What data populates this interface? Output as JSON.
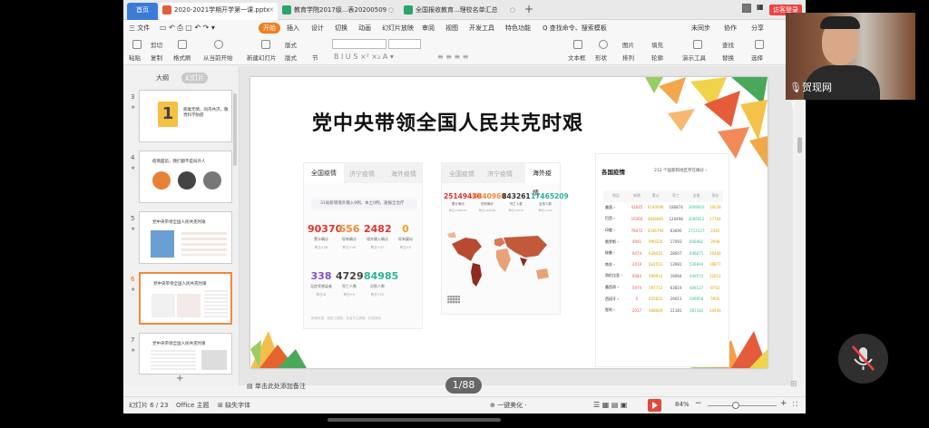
{
  "tabs": {
    "home": "首页",
    "t1": "2020-2021学期开学第一课.pptx",
    "t2": "教育学院2017级...表20200509",
    "t3": "全国报收教育...理校名单汇总",
    "login": "访客登录"
  },
  "menu": {
    "file": "三 文件",
    "items": [
      "开始",
      "插入",
      "设计",
      "切换",
      "动画",
      "幻灯片放映",
      "审阅",
      "视图",
      "开发工具",
      "特色功能"
    ],
    "search": "Q 查找命令、搜索模板",
    "right": [
      "未同步",
      "协作",
      "分享"
    ]
  },
  "ribbon": {
    "paste": "粘贴",
    "cut": "剪切",
    "copy": "复制",
    "format_painter": "格式刷",
    "from_current": "从当前开始",
    "new_slide": "新建幻灯片",
    "layout": "版式",
    "section": "节",
    "textbox": "文本框",
    "shape": "形状",
    "arrange": "排列",
    "outline": "轮廓",
    "picture": "图片",
    "fill": "填充",
    "find": "查找",
    "present_tool": "演示工具",
    "replace": "替换",
    "select": "选择"
  },
  "left_panel": {
    "tab_outline": "大纲",
    "tab_slides": "幻灯片",
    "slide_numbers": [
      "3",
      "4",
      "5",
      "6",
      "7"
    ],
    "thumb_titles": {
      "s3": "病毒无情，同舟共济，敬畏科学防疫",
      "s4": "疫情面前，我们都不是局外人",
      "s5": "党中央带领全国人民共克时艰",
      "s6": "党中央带领全国人民共克时艰",
      "s7": "党中央带领全国人民共克时艰"
    }
  },
  "slide": {
    "title": "党中央带领全国人民共克时艰",
    "china_panel": {
      "tabs": [
        "全国疫情",
        "济宁疫情",
        "海外疫情"
      ],
      "notice": "31省新增境外输入9例，本土0例，速报全治疗",
      "stats_row1": [
        {
          "value": "90370",
          "label": "累计确诊",
          "delta": "昨日+28",
          "color": "#e5322f"
        },
        {
          "value": "656",
          "label": "现有确诊",
          "delta": "昨日+40",
          "color": "#f08a3a"
        },
        {
          "value": "2482",
          "label": "境外输入确诊",
          "delta": "昨日+37",
          "color": "#e5322f"
        },
        {
          "value": "0",
          "label": "现有疑似",
          "delta": "昨日+0",
          "color": "#f0a020"
        }
      ],
      "stats_row2": [
        {
          "value": "338",
          "label": "无症状感染者",
          "delta": "昨日-6",
          "color": "#7b52c8"
        },
        {
          "value": "4729",
          "label": "死亡人数",
          "delta": "昨日+0",
          "color": "#444444"
        },
        {
          "value": "84985",
          "label": "治愈人数",
          "delta": "昨日+12",
          "color": "#2db596"
        }
      ],
      "footnote": "数据来源：国家卫健委、各省市卫健委、权威媒体"
    },
    "world_panel": {
      "tabs": [
        "全国疫情",
        "济宁疫情",
        "海外疫情"
      ],
      "stats": [
        {
          "value": "25149430",
          "label": "累计确诊",
          "delta": "昨日+256783",
          "color": "#e5322f"
        },
        {
          "value": "6840960",
          "label": "现有确诊",
          "delta": "昨日+42536",
          "color": "#f08a3a"
        },
        {
          "value": "843261",
          "label": "死亡人数",
          "delta": "昨日+5412",
          "color": "#333333"
        },
        {
          "value": "17465209",
          "label": "治愈人数",
          "delta": "昨日+216",
          "color": "#2db596"
        }
      ]
    },
    "country_panel": {
      "title": "各国疫情",
      "region_count": "212 个国家和地区存在确诊 ›",
      "headers": [
        "地区",
        "新增",
        "累计",
        "死亡",
        "治愈",
        "现存"
      ],
      "rows": [
        [
          "美国 ›",
          "42645",
          "6140096",
          "186874",
          "3409003",
          "16638"
        ],
        [
          "巴西 ›",
          "16360",
          "3846965",
          "120498",
          "3006812",
          "17704"
        ],
        [
          "印度 ›",
          "78472",
          "3546794",
          "63690",
          "2713127",
          "2392"
        ],
        [
          "俄罗斯 ›",
          "4941",
          "990326",
          "17093",
          "806982",
          "2698"
        ],
        [
          "秘鲁 ›",
          "9474",
          "639435",
          "28607",
          "446675",
          "19406"
        ],
        [
          "南非 ›",
          "2419",
          "622551",
          "13981",
          "536694",
          "19877"
        ],
        [
          "哥伦比亚 ›",
          "9384",
          "599914",
          "19064",
          "440574",
          "12012"
        ],
        [
          "墨西哥 ›",
          "5974",
          "597712",
          "63819",
          "409127",
          "8702"
        ],
        [
          "西班牙 ›",
          "0",
          "455621",
          "29011",
          "196958",
          "5902"
        ],
        [
          "智利 ›",
          "2037",
          "408009",
          "11181",
          "381183",
          "19446"
        ]
      ]
    }
  },
  "notes_placeholder": "单击此处添加备注",
  "page_counter": "1/88",
  "status": {
    "slide_pos": "幻灯片 6 / 23",
    "theme": "Office 主题",
    "missing_font": "缺失字体",
    "beautify": "一键美化 ·",
    "zoom": "84%"
  },
  "webcam_label": "贺现网",
  "colors": {
    "accent_orange": "#f08020",
    "wps_blue": "#3b7bd8",
    "confirm_red": "#e5322f"
  }
}
